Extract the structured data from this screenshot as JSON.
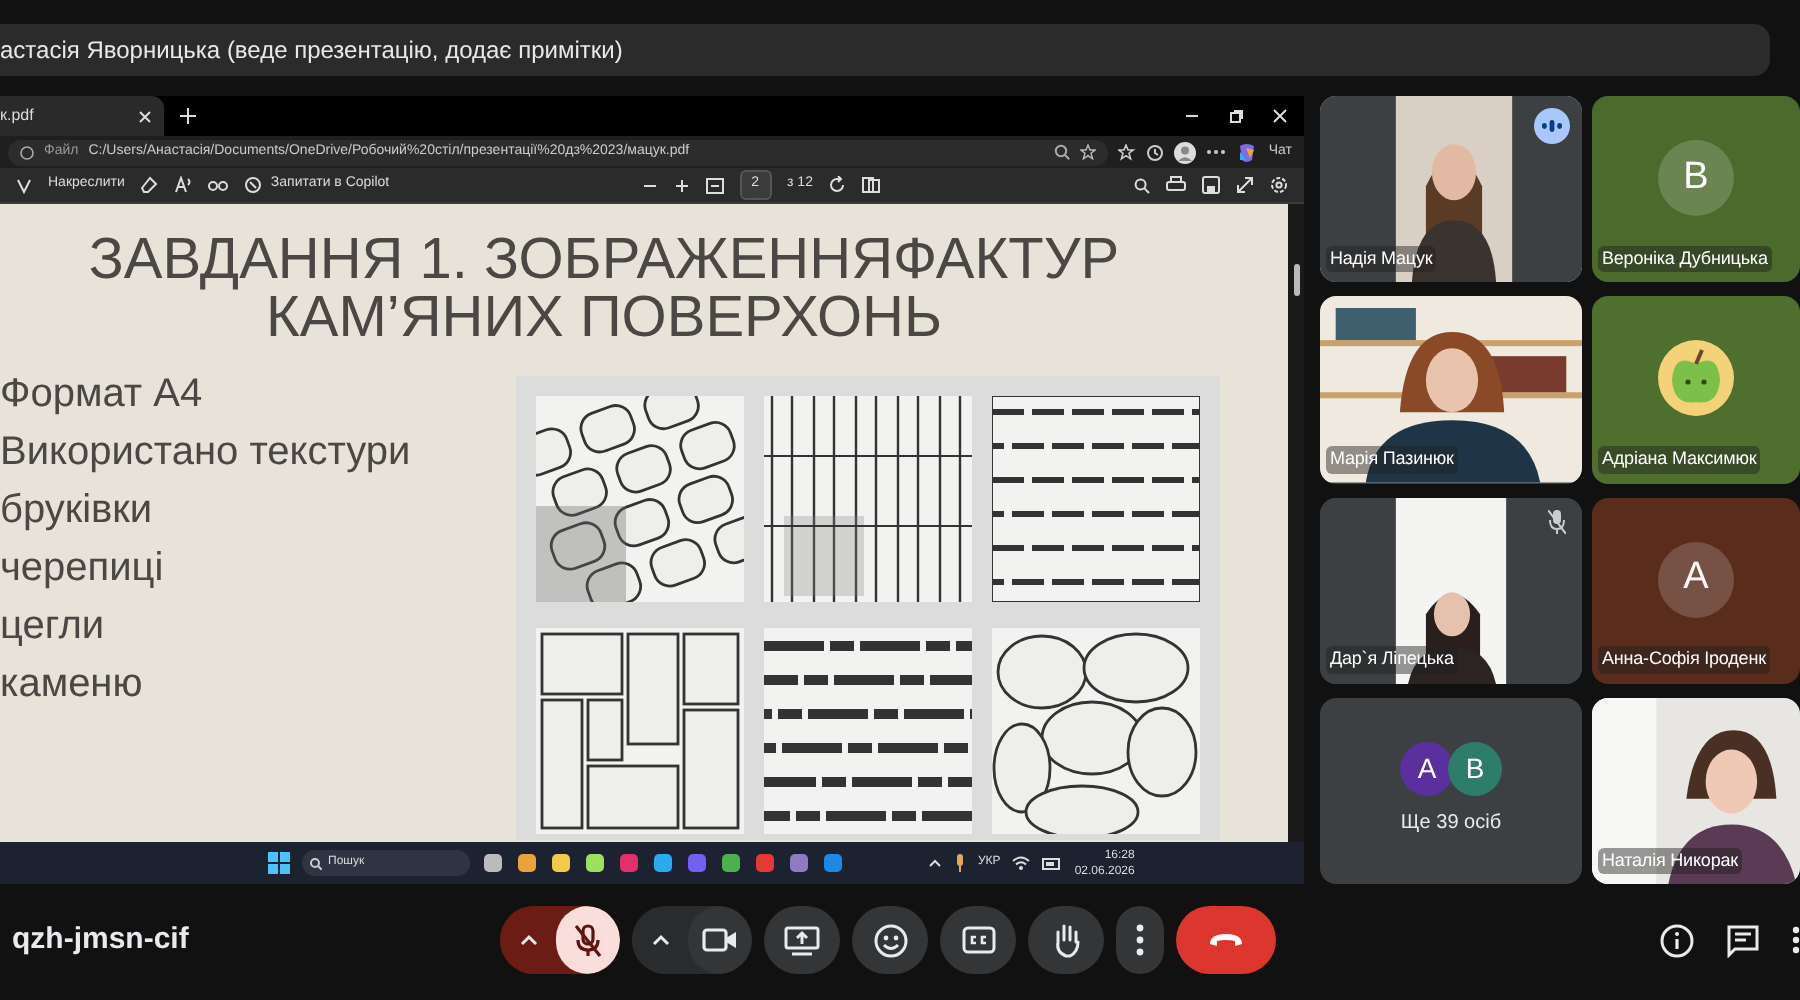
{
  "presenter_banner": "астасія Яворницька (веде презентацію, додає примітки)",
  "shared_screen": {
    "browser": {
      "tab_title": "к.pdf",
      "address_label": "Файл",
      "url": "C:/Users/Анастасія/Documents/OneDrive/Робочий%20стіл/презентації%20дз%2023/мацук.pdf",
      "chat": "Чат"
    },
    "pdf_toolbar": {
      "draw": "Накреслити",
      "copilot": "Запитати в Copilot",
      "page": "2",
      "page_total": "з 12"
    },
    "slide": {
      "title_lines": [
        "ЗАВДАННЯ 1. ЗОБРАЖЕННЯФАКТУР",
        "КАМ’ЯНИХ ПОВЕРХОНЬ"
      ],
      "bullets": [
        "Формат А4",
        "Використано текстури",
        "бруківки",
        "черепиці",
        "цегли",
        "каменю"
      ]
    },
    "taskbar": {
      "search": "Пошук",
      "language": "УКР",
      "time": "16:28",
      "date": "02.06.2026"
    }
  },
  "participants": [
    {
      "name": "Надія Мацук",
      "kind": "video",
      "speaking": true,
      "muted": false
    },
    {
      "name": "Вероніка Дубницька",
      "kind": "initial",
      "initial": "В",
      "color": "#4b6b2c",
      "speaking": false,
      "muted": false
    },
    {
      "name": "Марія Пазинюк",
      "kind": "video",
      "speaking": false,
      "muted": false
    },
    {
      "name": "Адріана Максимюк",
      "color": "#4f6f2e",
      "speaking": false,
      "muted": false
    },
    {
      "name": "Дар`я Ліпецька",
      "kind": "video",
      "speaking": false,
      "muted": true
    },
    {
      "name": "Анна-Софія Іроденк",
      "kind": "initial",
      "initial": "А",
      "color": "#5a2c1c",
      "speaking": false,
      "muted": false
    },
    {
      "kind": "more",
      "initials": [
        {
          "letter": "А",
          "color": "#5b2f9e"
        },
        {
          "letter": "В",
          "color": "#2e7d6a"
        }
      ],
      "label": "Ще 39 осіб"
    },
    {
      "name": "Наталія Никорак",
      "kind": "video",
      "speaking": false,
      "muted": false
    }
  ],
  "meeting_code": "qzh-jmsn-cif",
  "controls": {
    "mic_muted": true,
    "camera_on": true
  }
}
